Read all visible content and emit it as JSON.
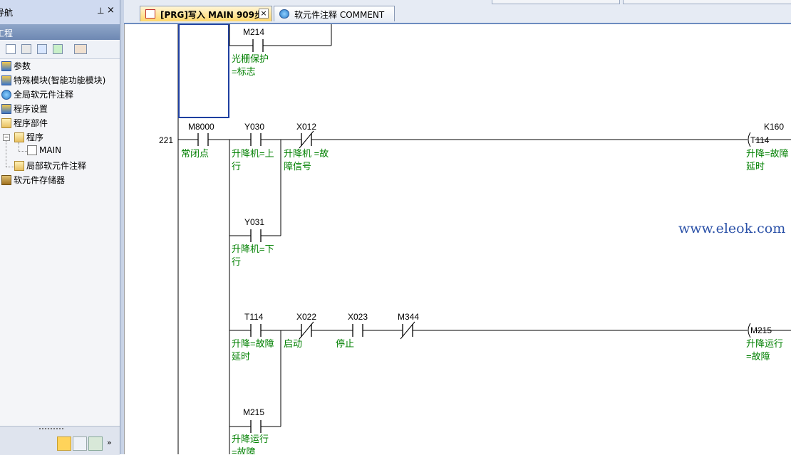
{
  "sidebar": {
    "title": "导航",
    "subtitle": "工程",
    "pin_glyph": "ₚ",
    "close_glyph": "×",
    "tree": [
      {
        "label": "参数",
        "icon": "parameter-icon"
      },
      {
        "label": "特殊模块(智能功能模块)",
        "icon": "module-icon"
      },
      {
        "label": "全局软元件注释",
        "icon": "globe-comment-icon"
      },
      {
        "label": "程序设置",
        "icon": "program-setting-icon"
      },
      {
        "label": "程序部件",
        "icon": "folder-icon"
      },
      {
        "label": "程序",
        "icon": "folder-icon"
      },
      {
        "label": "MAIN",
        "icon": "program-doc-icon"
      },
      {
        "label": "局部软元件注释",
        "icon": "folder-icon"
      },
      {
        "label": "软元件存储器",
        "icon": "memory-icon"
      }
    ]
  },
  "tabs": [
    {
      "label": "[PRG]写入 MAIN 909步",
      "active": true
    },
    {
      "label": "软元件注释 COMMENT",
      "active": false
    }
  ],
  "tab_close_glyph": "×",
  "ladder": {
    "step_number": "221",
    "contacts": [
      {
        "device": "M214",
        "comment": [
          "光栅保护",
          "=标志"
        ]
      },
      {
        "device": "M8000",
        "comment": [
          "常闭点"
        ]
      },
      {
        "device": "Y030",
        "comment": [
          "升降机=上",
          "行"
        ]
      },
      {
        "device": "X012",
        "comment": [
          "升降机 =故",
          "障信号"
        ]
      },
      {
        "device": "Y031",
        "comment": [
          "升降机=下",
          "行"
        ]
      },
      {
        "device": "T114",
        "comment": [
          "升降=故障",
          "延时"
        ]
      },
      {
        "device": "X022",
        "comment": [
          "启动"
        ]
      },
      {
        "device": "X023",
        "comment": [
          "停止"
        ]
      },
      {
        "device": "M344",
        "comment": []
      },
      {
        "device": "M215",
        "comment": [
          "升降运行",
          "=故障"
        ]
      }
    ],
    "coils": [
      {
        "device": "T114",
        "setting": "K160",
        "comment": [
          "升降=故障",
          "延时"
        ]
      },
      {
        "device": "M215",
        "setting": "",
        "comment": [
          "升降运行",
          "=故障"
        ]
      }
    ]
  },
  "watermark": "www.eleok.com",
  "colors": {
    "comment_text": "#008000",
    "selection_box": "#1e3fa0",
    "tab_active": "#ffd76a",
    "watermark": "#2c52a8"
  }
}
